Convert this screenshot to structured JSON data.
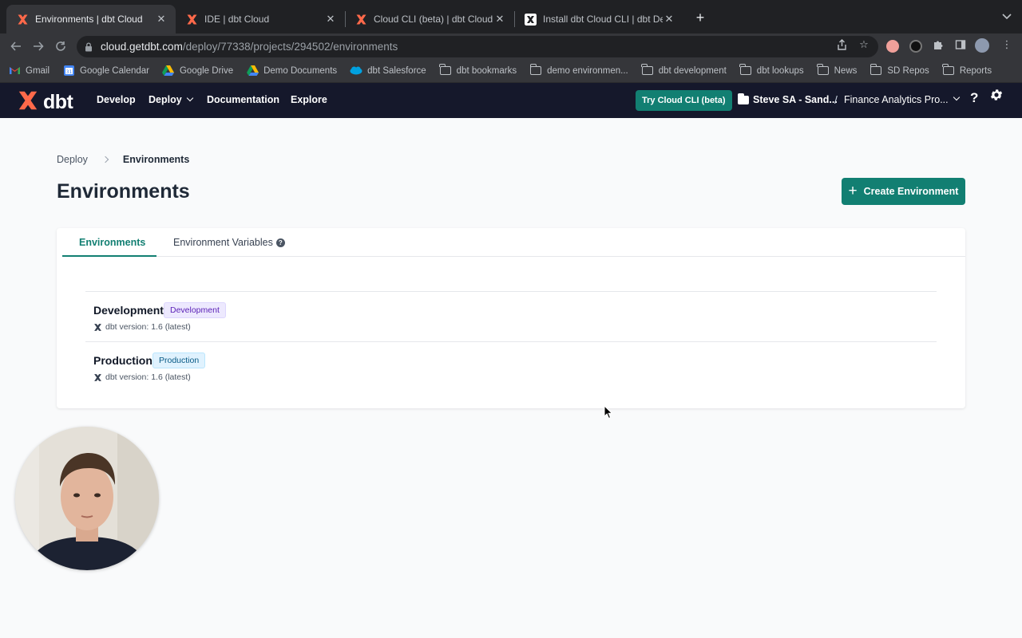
{
  "browser": {
    "tabs": [
      {
        "title": "Environments | dbt Cloud",
        "icon": "dbt-logo-icon"
      },
      {
        "title": "IDE | dbt Cloud",
        "icon": "dbt-logo-icon"
      },
      {
        "title": "Cloud CLI (beta) | dbt Cloud",
        "icon": "dbt-logo-icon"
      },
      {
        "title": "Install dbt Cloud CLI | dbt Dev",
        "icon": "dbt-docs-icon"
      }
    ],
    "url": {
      "host": "cloud.getdbt.com",
      "path": "/deploy/77338/projects/294502/environments"
    },
    "bookmarks": [
      {
        "label": "Gmail",
        "icon": "gmail-icon"
      },
      {
        "label": "Google Calendar",
        "icon": "calendar-icon"
      },
      {
        "label": "Google Drive",
        "icon": "drive-icon"
      },
      {
        "label": "Demo Documents",
        "icon": "drive-icon"
      },
      {
        "label": "dbt Salesforce",
        "icon": "salesforce-icon"
      },
      {
        "label": "dbt bookmarks",
        "icon": "folder-icon"
      },
      {
        "label": "demo environmen...",
        "icon": "folder-icon"
      },
      {
        "label": "dbt development",
        "icon": "folder-icon"
      },
      {
        "label": "dbt lookups",
        "icon": "folder-icon"
      },
      {
        "label": "News",
        "icon": "folder-icon"
      },
      {
        "label": "SD Repos",
        "icon": "folder-icon"
      },
      {
        "label": "Reports",
        "icon": "folder-icon"
      }
    ]
  },
  "app": {
    "logo_text": "dbt",
    "nav": {
      "develop": "Develop",
      "deploy": "Deploy",
      "documentation": "Documentation",
      "explore": "Explore"
    },
    "try_cli": "Try Cloud CLI (beta)",
    "account": "Steve SA - Sand...",
    "separator": "/",
    "project": "Finance Analytics Pro...",
    "help": "?",
    "brand_color": "#127f72",
    "nav_bg": "#15182b"
  },
  "page": {
    "breadcrumb": {
      "parent": "Deploy",
      "current": "Environments"
    },
    "title": "Environments",
    "create_button": "Create Environment",
    "tabs": {
      "environments": "Environments",
      "variables": "Environment Variables"
    },
    "environments": [
      {
        "name": "Development",
        "badge": "Development",
        "version": "dbt version: 1.6 (latest)"
      },
      {
        "name": "Production",
        "badge": "Production",
        "version": "dbt version: 1.6 (latest)"
      }
    ]
  }
}
